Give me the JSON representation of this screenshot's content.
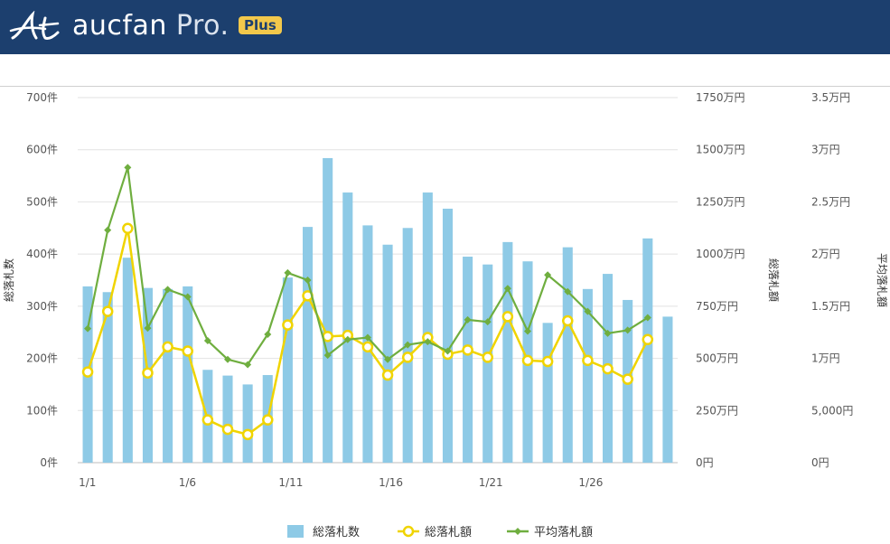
{
  "header": {
    "brand_name": "aucfan",
    "brand_pro": "Pro.",
    "badge": "Plus",
    "background_color": "#1c3f6e",
    "badge_color": "#f2c84b",
    "logo_icon": "aucfan-logo-icon"
  },
  "chart_data": {
    "type": "bar",
    "x": [
      "1/1",
      "1/2",
      "1/3",
      "1/4",
      "1/5",
      "1/6",
      "1/7",
      "1/8",
      "1/9",
      "1/10",
      "1/11",
      "1/12",
      "1/13",
      "1/14",
      "1/15",
      "1/16",
      "1/17",
      "1/18",
      "1/19",
      "1/20",
      "1/21",
      "1/22",
      "1/23",
      "1/24",
      "1/25",
      "1/26",
      "1/27",
      "1/28",
      "1/29",
      "1/30"
    ],
    "x_tick_labels": [
      "1/1",
      "1/6",
      "1/11",
      "1/16",
      "1/21",
      "1/26"
    ],
    "series": [
      {
        "name": "総落札数",
        "kind": "bar",
        "axis": "left",
        "color": "#8ecae6",
        "values": [
          338,
          327,
          393,
          335,
          333,
          338,
          178,
          167,
          150,
          168,
          355,
          452,
          584,
          518,
          455,
          418,
          450,
          518,
          487,
          395,
          380,
          423,
          386,
          268,
          413,
          333,
          362,
          312,
          430,
          280
        ]
      },
      {
        "name": "総落札額",
        "kind": "line",
        "axis": "right1",
        "color": "#f0d400",
        "values": [
          435,
          725,
          1123,
          430,
          555,
          535,
          205,
          160,
          135,
          205,
          660,
          800,
          605,
          610,
          555,
          420,
          505,
          600,
          520,
          540,
          505,
          700,
          490,
          485,
          680,
          490,
          450,
          400,
          590,
          0
        ]
      },
      {
        "name": "平均落札額",
        "kind": "line",
        "axis": "right2",
        "color": "#6fae3f",
        "values": [
          12850,
          22300,
          28300,
          12900,
          16600,
          15900,
          11700,
          9900,
          9400,
          12300,
          18200,
          17500,
          10300,
          11800,
          12000,
          9900,
          11300,
          11600,
          10700,
          13700,
          13500,
          16700,
          12600,
          18000,
          16400,
          14500,
          12400,
          12700,
          13900,
          0
        ]
      }
    ],
    "axes": {
      "left": {
        "title": "総落札数",
        "range": [
          0,
          700
        ],
        "tick_labels": [
          "0件",
          "100件",
          "200件",
          "300件",
          "400件",
          "500件",
          "600件",
          "700件"
        ]
      },
      "right1": {
        "title": "総落札額",
        "range": [
          0,
          17500000
        ],
        "tick_labels": [
          "0円",
          "250万円",
          "500万円",
          "750万円",
          "1000万円",
          "1250万円",
          "1500万円",
          "1750万円"
        ]
      },
      "right2": {
        "title": "平均落札額",
        "range": [
          0,
          35000
        ],
        "tick_labels": [
          "0円",
          "5,000円",
          "1万円",
          "1.5万円",
          "2万円",
          "2.5万円",
          "3万円",
          "3.5万円"
        ]
      }
    },
    "grid": true,
    "legend_position": "bottom-center",
    "legend": [
      "総落札数",
      "総落札額",
      "平均落札額"
    ]
  }
}
